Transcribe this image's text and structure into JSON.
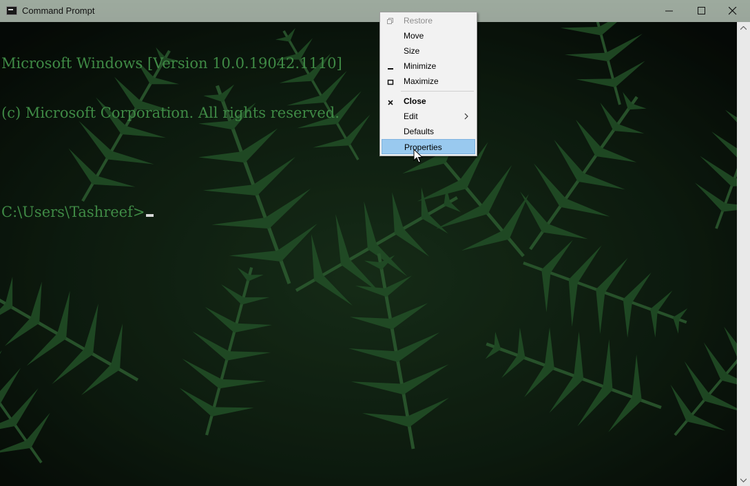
{
  "window": {
    "title": "Command Prompt",
    "controls": {
      "minimize": "minimize-icon",
      "maximize": "maximize-icon",
      "close": "close-icon"
    }
  },
  "console": {
    "lines": [
      "Microsoft Windows [Version 10.0.19042.1110]",
      "(c) Microsoft Corporation. All rights reserved.",
      "",
      "C:\\Users\\Tashreef>"
    ],
    "text_color": "#3f8a45"
  },
  "context_menu": {
    "items": [
      {
        "label": "Restore",
        "disabled": true,
        "icon": "restore-icon"
      },
      {
        "label": "Move"
      },
      {
        "label": "Size"
      },
      {
        "label": "Minimize",
        "icon": "minimize-icon"
      },
      {
        "label": "Maximize",
        "icon": "maximize-icon"
      },
      {
        "label": "Close",
        "bold": true,
        "icon": "close-icon"
      },
      {
        "label": "Edit",
        "submenu": true
      },
      {
        "label": "Defaults"
      },
      {
        "label": "Properties",
        "highlighted": true
      }
    ],
    "highlight_color": "#99c9ef"
  }
}
